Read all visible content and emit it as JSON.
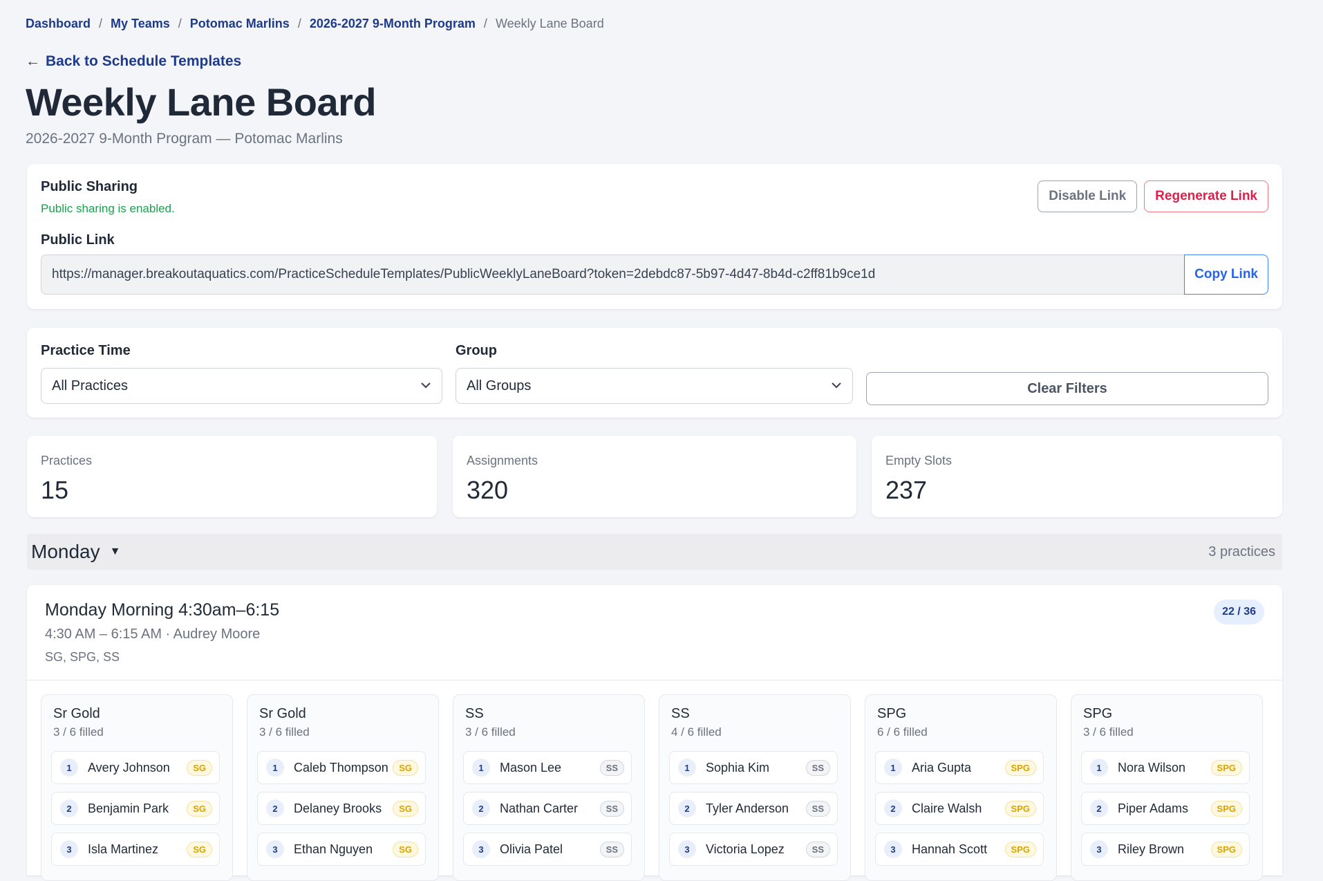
{
  "breadcrumb": [
    {
      "label": "Dashboard"
    },
    {
      "label": "My Teams"
    },
    {
      "label": "Potomac Marlins"
    },
    {
      "label": "2026-2027 9-Month Program"
    },
    {
      "label": "Weekly Lane Board"
    }
  ],
  "back_link": {
    "arrow": "←",
    "label": "Back to Schedule Templates"
  },
  "page": {
    "title": "Weekly Lane Board",
    "subtitle": "2026-2027 9-Month Program — Potomac Marlins"
  },
  "sharing": {
    "title": "Public Sharing",
    "status": "Public sharing is enabled.",
    "status_color": "#16a34a",
    "disable_label": "Disable Link",
    "regenerate_label": "Regenerate Link",
    "link_label": "Public Link",
    "link_value": "https://manager.breakoutaquatics.com/PracticeScheduleTemplates/PublicWeeklyLaneBoard?token=2debdc87-5b97-4d47-8b4d-c2ff81b9ce1d",
    "copy_label": "Copy Link"
  },
  "filters": {
    "practice_time_label": "Practice Time",
    "practice_time_value": "All Practices",
    "group_label": "Group",
    "group_value": "All Groups",
    "clear_label": "Clear Filters"
  },
  "stats": [
    {
      "label": "Practices",
      "value": "15"
    },
    {
      "label": "Assignments",
      "value": "320"
    },
    {
      "label": "Empty Slots",
      "value": "237"
    }
  ],
  "day": {
    "name": "Monday",
    "toggle_icon": "▼",
    "practice_count": "3 practices"
  },
  "practice": {
    "title": "Monday Morning 4:30am–6:15",
    "meta": "4:30 AM – 6:15 AM · Audrey Moore",
    "groups": "SG, SPG, SS",
    "fill": "22 / 36"
  },
  "lanes": [
    {
      "name": "Sr Gold",
      "filled": "3 / 6 filled",
      "swimmers": [
        {
          "num": "1",
          "name": "Avery Johnson",
          "badge": "SG"
        },
        {
          "num": "2",
          "name": "Benjamin Park",
          "badge": "SG"
        },
        {
          "num": "3",
          "name": "Isla Martinez",
          "badge": "SG"
        }
      ]
    },
    {
      "name": "Sr Gold",
      "filled": "3 / 6 filled",
      "swimmers": [
        {
          "num": "1",
          "name": "Caleb Thompson",
          "badge": "SG"
        },
        {
          "num": "2",
          "name": "Delaney Brooks",
          "badge": "SG"
        },
        {
          "num": "3",
          "name": "Ethan Nguyen",
          "badge": "SG"
        }
      ]
    },
    {
      "name": "SS",
      "filled": "3 / 6 filled",
      "swimmers": [
        {
          "num": "1",
          "name": "Mason Lee",
          "badge": "SS"
        },
        {
          "num": "2",
          "name": "Nathan Carter",
          "badge": "SS"
        },
        {
          "num": "3",
          "name": "Olivia Patel",
          "badge": "SS"
        }
      ]
    },
    {
      "name": "SS",
      "filled": "4 / 6 filled",
      "swimmers": [
        {
          "num": "1",
          "name": "Sophia Kim",
          "badge": "SS"
        },
        {
          "num": "2",
          "name": "Tyler Anderson",
          "badge": "SS"
        },
        {
          "num": "3",
          "name": "Victoria Lopez",
          "badge": "SS"
        }
      ]
    },
    {
      "name": "SPG",
      "filled": "6 / 6 filled",
      "swimmers": [
        {
          "num": "1",
          "name": "Aria Gupta",
          "badge": "SPG"
        },
        {
          "num": "2",
          "name": "Claire Walsh",
          "badge": "SPG"
        },
        {
          "num": "3",
          "name": "Hannah Scott",
          "badge": "SPG"
        }
      ]
    },
    {
      "name": "SPG",
      "filled": "3 / 6 filled",
      "swimmers": [
        {
          "num": "1",
          "name": "Nora Wilson",
          "badge": "SPG"
        },
        {
          "num": "2",
          "name": "Piper Adams",
          "badge": "SPG"
        },
        {
          "num": "3",
          "name": "Riley Brown",
          "badge": "SPG"
        }
      ]
    }
  ],
  "colors": {
    "brand_link": "#1e3a8a",
    "danger": "#e11d48",
    "primary": "#2563eb",
    "badge_gold": "#d9a400"
  }
}
